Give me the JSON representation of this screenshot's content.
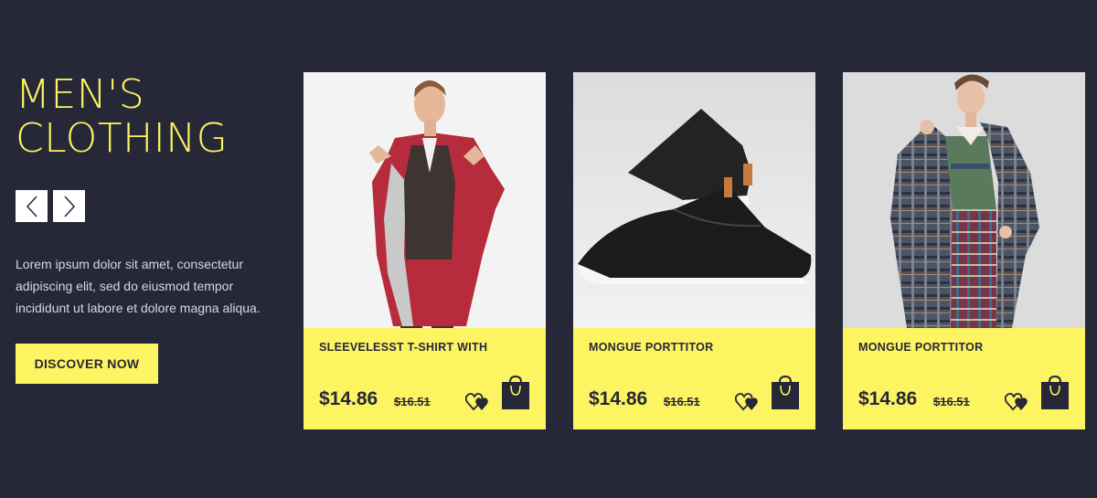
{
  "hero": {
    "title_line1": "MEN'S",
    "title_line2": "CLOTHING",
    "description": "Lorem ipsum dolor sit amet, consectetur adipiscing elit, sed do eiusmod tempor incididunt ut labore et dolore magna aliqua.",
    "cta_label": "DISCOVER NOW",
    "prev_icon": "chevron-left-icon",
    "next_icon": "chevron-right-icon"
  },
  "products": [
    {
      "name": "SLEEVELESST T-SHIRT WITH",
      "price": "$14.86",
      "old_price": "$16.51",
      "image": "man-in-red-coat"
    },
    {
      "name": "MONGUE PORTTITOR",
      "price": "$14.86",
      "old_price": "$16.51",
      "image": "black-leather-shoes"
    },
    {
      "name": "MONGUE PORTTITOR",
      "price": "$14.86",
      "old_price": "$16.51",
      "image": "woman-in-plaid-coat"
    }
  ],
  "colors": {
    "background": "#262838",
    "accent": "#fdf461",
    "text_dark": "#262838",
    "text_light": "#d6d8e2"
  },
  "icons": {
    "wishlist": "hearts-icon",
    "cart": "shopping-bag-icon"
  }
}
